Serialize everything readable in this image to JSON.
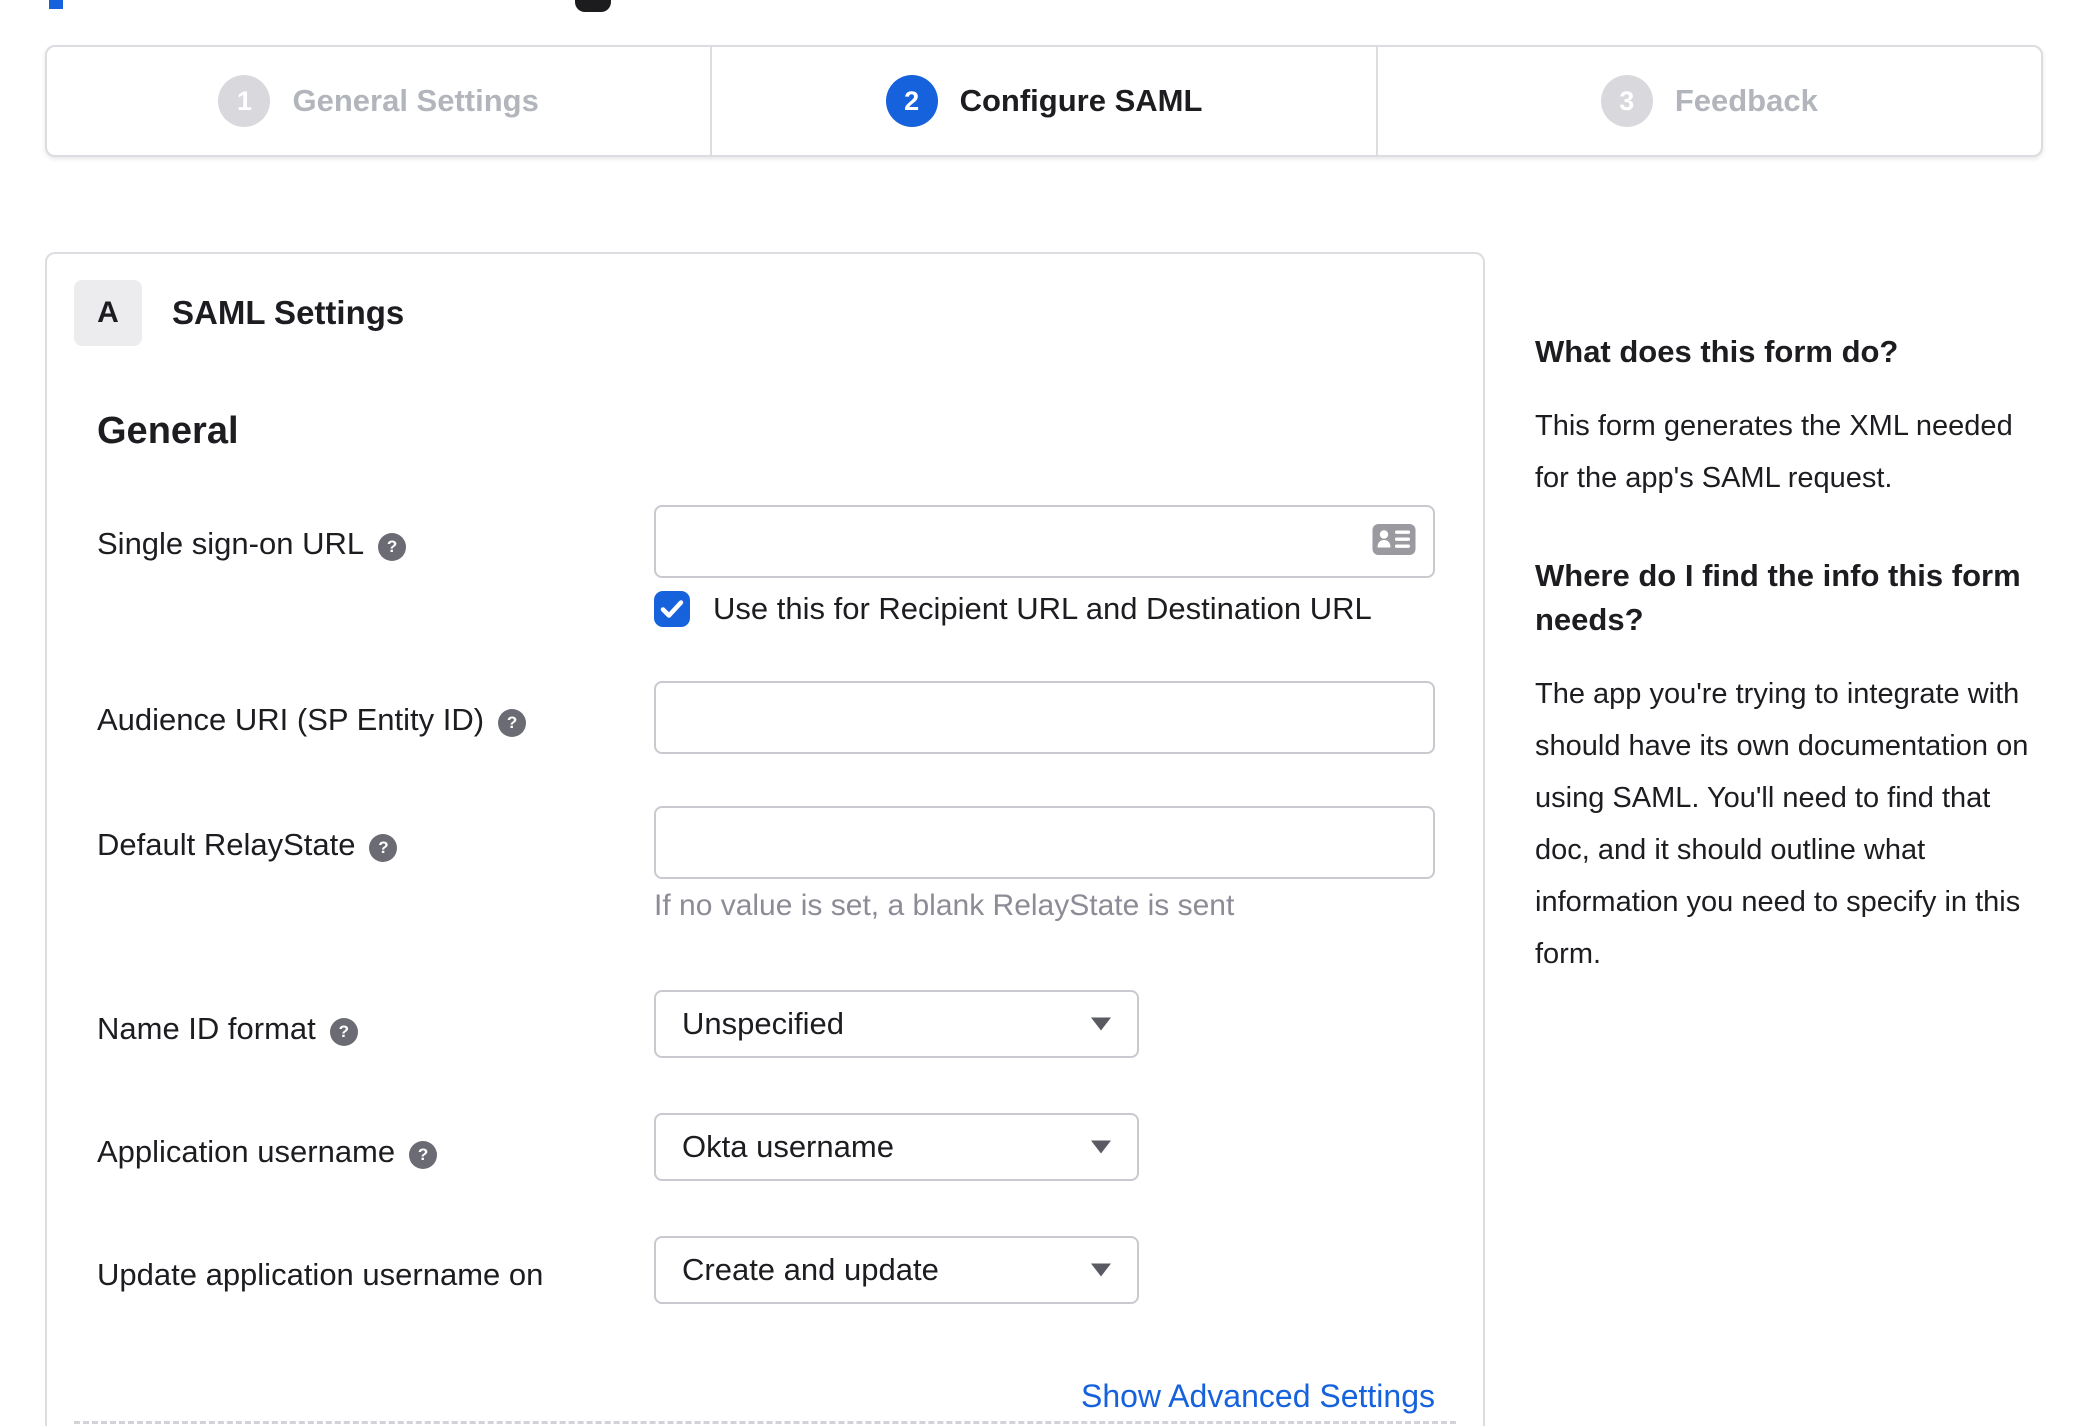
{
  "colors": {
    "accent_blue": "#1662dd",
    "text_dark": "#1d1d21",
    "inactive_gray": "#b2b5bb",
    "hint_gray": "#8c8c96"
  },
  "stepper": {
    "active_step": 2,
    "steps": [
      {
        "number": "1",
        "label": "General Settings"
      },
      {
        "number": "2",
        "label": "Configure SAML"
      },
      {
        "number": "3",
        "label": "Feedback"
      }
    ]
  },
  "panel": {
    "badge": "A",
    "title": "SAML Settings",
    "section_heading": "General",
    "advanced_settings_link": "Show Advanced Settings",
    "fields": {
      "sso_url": {
        "label": "Single sign-on URL",
        "value": "",
        "checkbox_label": "Use this for Recipient URL and Destination URL",
        "checkbox_checked": true
      },
      "audience_uri": {
        "label": "Audience URI (SP Entity ID)",
        "value": ""
      },
      "default_relay_state": {
        "label": "Default RelayState",
        "value": "",
        "hint": "If no value is set, a blank RelayState is sent"
      },
      "name_id_format": {
        "label": "Name ID format",
        "value": "Unspecified"
      },
      "application_username": {
        "label": "Application username",
        "value": "Okta username"
      },
      "update_app_username_on": {
        "label": "Update application username on",
        "value": "Create and update"
      }
    },
    "help_icon_glyph": "?"
  },
  "sidebar": {
    "q1_heading": "What does this form do?",
    "q1_body": "This form generates the XML needed for the app's SAML request.",
    "q2_heading": "Where do I find the info this form needs?",
    "q2_body": "The app you're trying to integrate with should have its own documentation on using SAML. You'll need to find that doc, and it should outline what information you need to specify in this form."
  }
}
